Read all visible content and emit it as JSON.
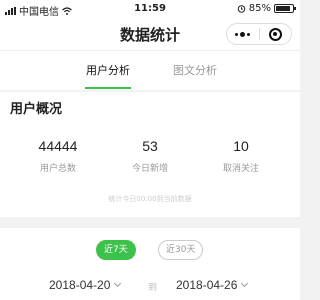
{
  "status_bar": {
    "carrier": "中国电信",
    "time": "11:59",
    "battery_percent": "85%",
    "battery_level": 0.85
  },
  "nav": {
    "title": "数据统计"
  },
  "tabs": [
    {
      "label": "用户分析",
      "active": true
    },
    {
      "label": "图文分析",
      "active": false
    }
  ],
  "overview": {
    "title": "用户概况",
    "stats": [
      {
        "value": "44444",
        "label": "用户总数"
      },
      {
        "value": "53",
        "label": "今日新增"
      },
      {
        "value": "10",
        "label": "取消关注"
      }
    ],
    "note": "统计今日00:00到当前数据"
  },
  "filter": {
    "ranges": [
      {
        "label": "近7天",
        "active": true
      },
      {
        "label": "近30天",
        "active": false
      }
    ],
    "start_date": "2018-04-20",
    "separator": "到",
    "end_date": "2018-04-26"
  },
  "colors": {
    "accent": "#3cc24b"
  }
}
